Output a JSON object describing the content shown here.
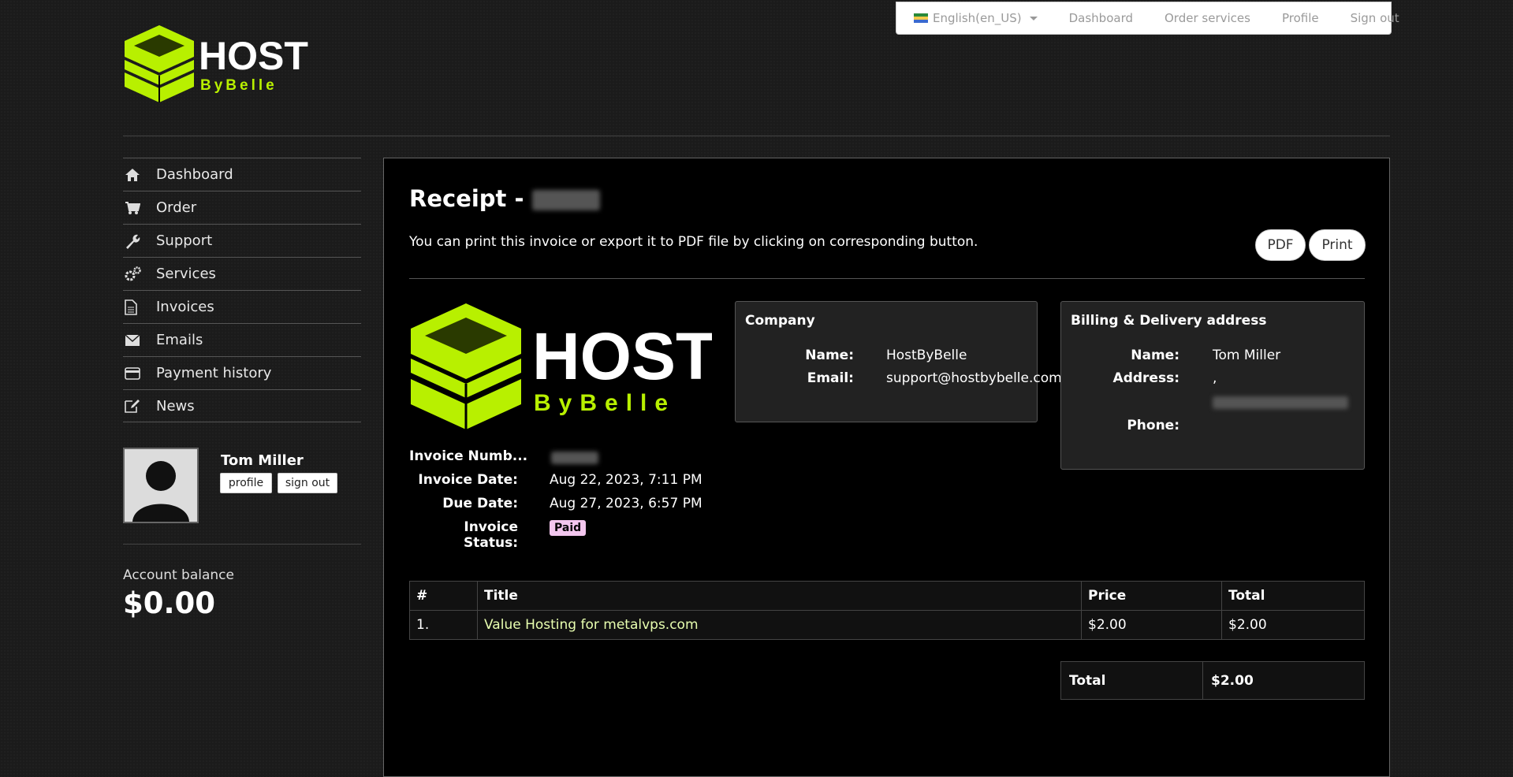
{
  "topbar": {
    "language": "English(en_US)",
    "links": [
      "Dashboard",
      "Order services",
      "Profile",
      "Sign out"
    ]
  },
  "brand": {
    "word1": "HOST",
    "word2": "ByBelle",
    "accent": "#b8f000"
  },
  "sidebar": {
    "items": [
      {
        "label": "Dashboard",
        "icon": "home-icon"
      },
      {
        "label": "Order",
        "icon": "cart-icon"
      },
      {
        "label": "Support",
        "icon": "wrench-icon"
      },
      {
        "label": "Services",
        "icon": "gears-icon"
      },
      {
        "label": "Invoices",
        "icon": "document-icon"
      },
      {
        "label": "Emails",
        "icon": "envelope-icon"
      },
      {
        "label": "Payment history",
        "icon": "credit-card-icon"
      },
      {
        "label": "News",
        "icon": "edit-icon"
      }
    ]
  },
  "user": {
    "name": "Tom Miller",
    "profile_label": "profile",
    "signout_label": "sign out"
  },
  "balance": {
    "label": "Account balance",
    "value": "$0.00"
  },
  "receipt": {
    "title": "Receipt -",
    "description": "You can print this invoice or export it to PDF file by clicking on corresponding button.",
    "pdf_label": "PDF",
    "print_label": "Print"
  },
  "invoice_meta": {
    "number_label": "Invoice Numb...",
    "date_label": "Invoice Date:",
    "date_value": "Aug 22, 2023, 7:11 PM",
    "due_label": "Due Date:",
    "due_value": "Aug 27, 2023, 6:57 PM",
    "status_label": "Invoice Status:",
    "status_value": "Paid"
  },
  "company": {
    "heading": "Company",
    "name_label": "Name:",
    "name_value": "HostByBelle",
    "email_label": "Email:",
    "email_value": "support@hostbybelle.com"
  },
  "billing": {
    "heading": "Billing & Delivery address",
    "name_label": "Name:",
    "name_value": "Tom Miller",
    "address_label": "Address:",
    "address_value": ",",
    "phone_label": "Phone:"
  },
  "items_table": {
    "headers": [
      "#",
      "Title",
      "Price",
      "Total"
    ],
    "rows": [
      {
        "num": "1.",
        "title": "Value Hosting for metalvps.com",
        "price": "$2.00",
        "total": "$2.00"
      }
    ]
  },
  "totals": {
    "label": "Total",
    "value": "$2.00"
  }
}
